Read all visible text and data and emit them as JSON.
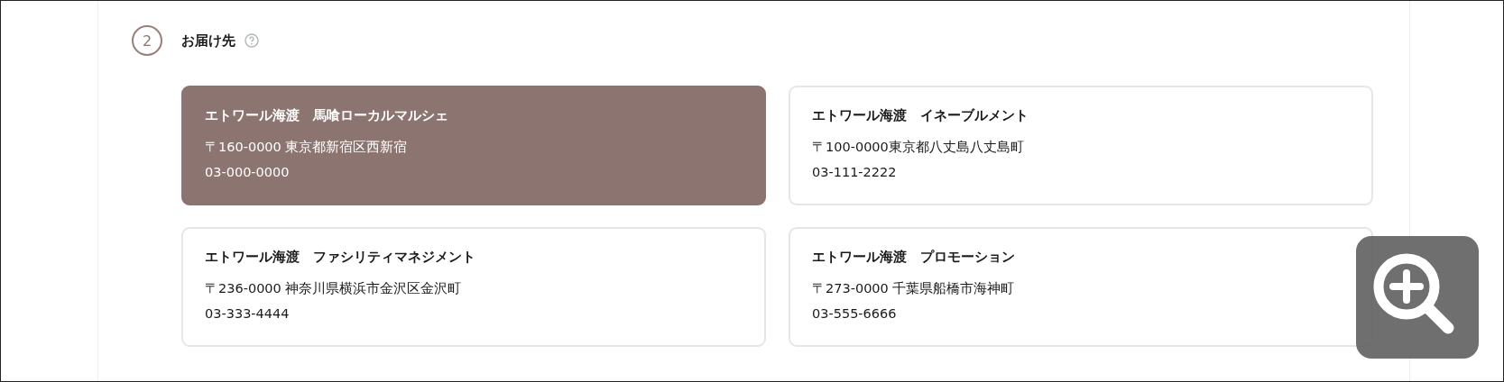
{
  "step": {
    "number": "2",
    "title": "お届け先"
  },
  "addresses": [
    {
      "name": "エトワール海渡　馬喰ローカルマルシェ",
      "address": "〒160-0000 東京都新宿区西新宿",
      "phone": "03-000-0000",
      "selected": true
    },
    {
      "name": "エトワール海渡　イネーブルメント",
      "address": "〒100-0000東京都八丈島八丈島町",
      "phone": "03-111-2222",
      "selected": false
    },
    {
      "name": "エトワール海渡　ファシリティマネジメント",
      "address": "〒236-0000 神奈川県横浜市金沢区金沢町",
      "phone": "03-333-4444",
      "selected": false
    },
    {
      "name": "エトワール海渡　プロモーション",
      "address": "〒273-0000 千葉県船橋市海神町",
      "phone": "03-555-6666",
      "selected": false
    }
  ]
}
